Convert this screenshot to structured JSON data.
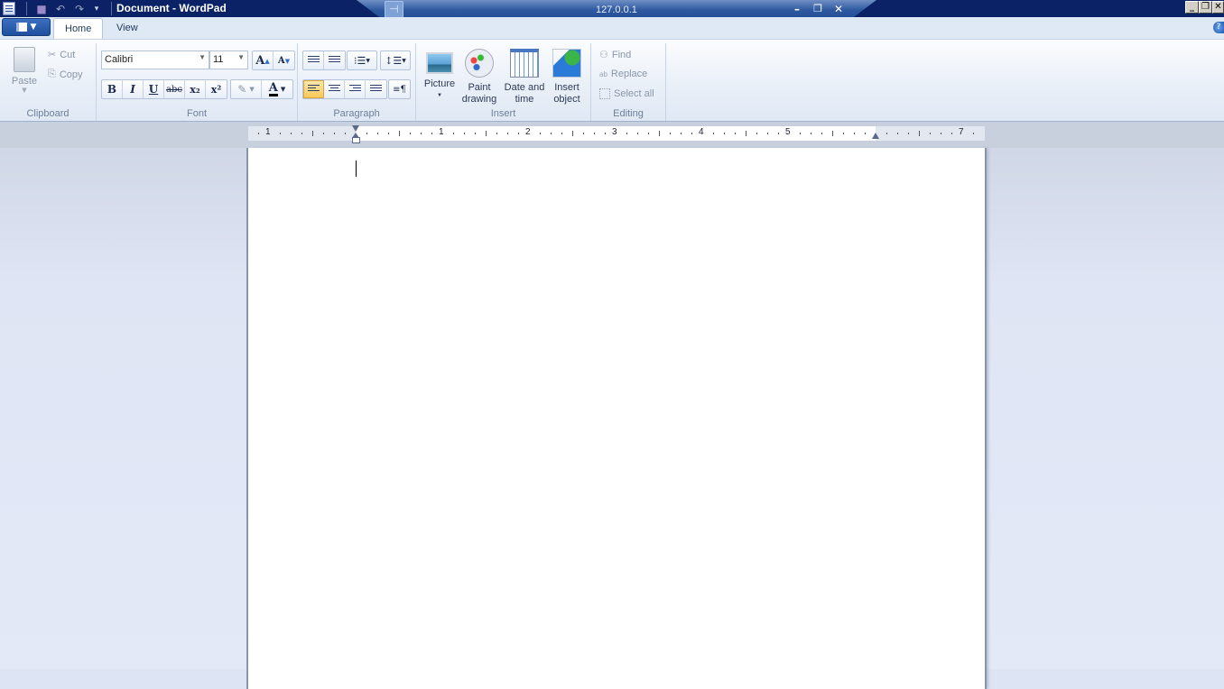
{
  "window": {
    "title": "Document - WordPad",
    "remote_host": "127.0.0.1"
  },
  "quick_access": {
    "items": [
      "save-icon",
      "undo-icon",
      "redo-icon",
      "customize-dropdown-icon"
    ]
  },
  "tabs": [
    {
      "label": "Home",
      "active": true
    },
    {
      "label": "View",
      "active": false
    }
  ],
  "ribbon": {
    "clipboard": {
      "label": "Clipboard",
      "paste": "Paste",
      "cut": "Cut",
      "copy": "Copy"
    },
    "font": {
      "label": "Font",
      "family": "Calibri",
      "size": "11",
      "bold": "B",
      "italic": "I",
      "underline": "U",
      "strikethrough": "abc",
      "subscript": "x₂",
      "superscript": "x²",
      "text_color_label": "A",
      "text_color": "#000000"
    },
    "paragraph": {
      "label": "Paragraph",
      "active_alignment": "left"
    },
    "insert": {
      "label": "Insert",
      "picture": "Picture",
      "paint_line1": "Paint",
      "paint_line2": "drawing",
      "datetime_line1": "Date and",
      "datetime_line2": "time",
      "object_line1": "Insert",
      "object_line2": "object"
    },
    "editing": {
      "label": "Editing",
      "find": "Find",
      "replace": "Replace",
      "select_all": "Select all"
    }
  },
  "ruler": {
    "numbers": [
      "1",
      "1",
      "2",
      "3",
      "4",
      "5",
      "7"
    ]
  },
  "document": {
    "content": ""
  }
}
